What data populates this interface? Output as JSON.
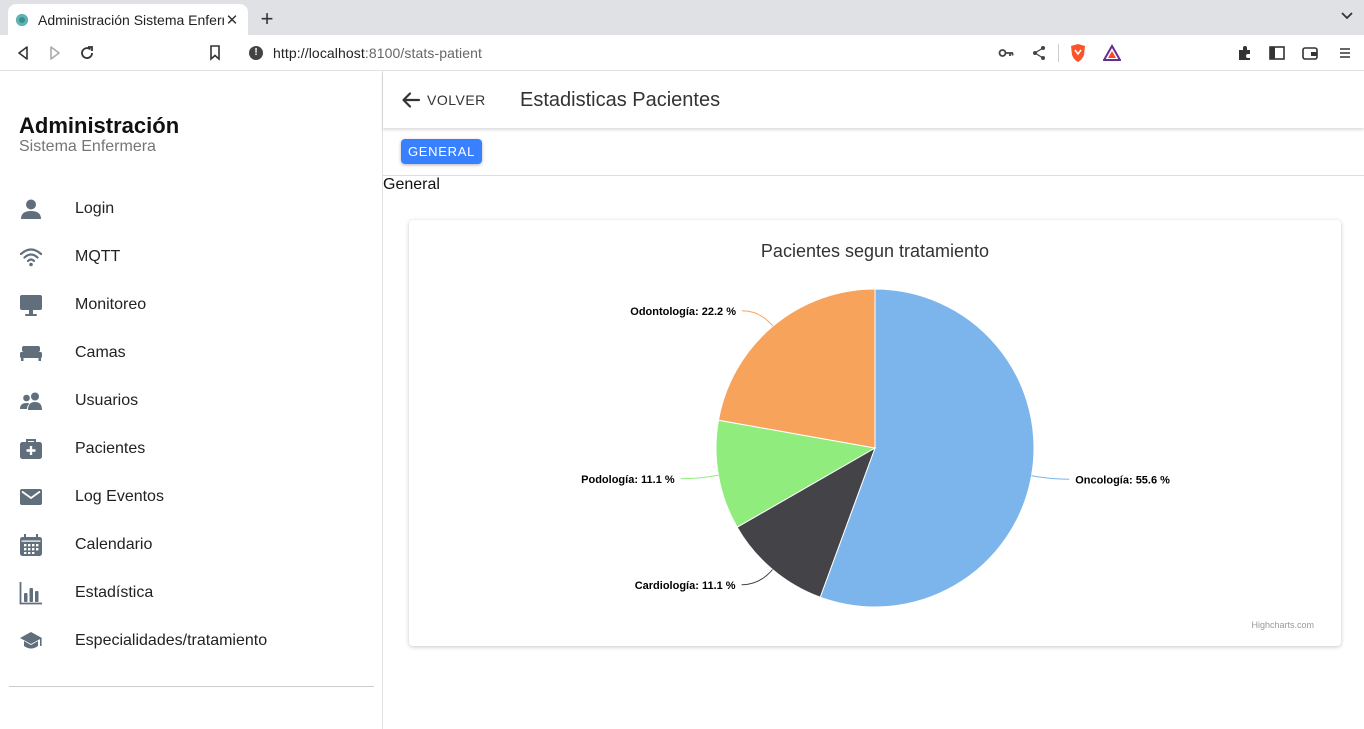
{
  "browser": {
    "tab_title": "Administración Sistema Enfermera",
    "tab_close": "✕",
    "new_tab": "+",
    "url_host": "http://localhost",
    "url_path": ":8100/stats-patient"
  },
  "sidebar": {
    "title": "Administración",
    "subtitle": "Sistema Enfermera",
    "items": [
      {
        "label": "Login",
        "icon": "person-icon"
      },
      {
        "label": "MQTT",
        "icon": "wifi-icon"
      },
      {
        "label": "Monitoreo",
        "icon": "desktop-icon"
      },
      {
        "label": "Camas",
        "icon": "bed-icon"
      },
      {
        "label": "Usuarios",
        "icon": "people-icon"
      },
      {
        "label": "Pacientes",
        "icon": "medkit-icon"
      },
      {
        "label": "Log Eventos",
        "icon": "mail-icon"
      },
      {
        "label": "Calendario",
        "icon": "calendar-icon"
      },
      {
        "label": "Estadística",
        "icon": "stats-chart-icon"
      },
      {
        "label": "Especialidades/tratamiento",
        "icon": "school-icon"
      }
    ]
  },
  "header": {
    "back_label": "VOLVER",
    "title": "Estadisticas Pacientes"
  },
  "segment": {
    "button_label": "GENERAL"
  },
  "section_label": "General",
  "chart_data": {
    "type": "pie",
    "title": "Pacientes segun tratamiento",
    "credits": "Highcharts.com",
    "slices": [
      {
        "name": "Oncología",
        "value": 55.6,
        "label": "Oncología: 55.6 %",
        "color": "#7cb5ec"
      },
      {
        "name": "Cardiología",
        "value": 11.1,
        "label": "Cardiología: 11.1 %",
        "color": "#434348"
      },
      {
        "name": "Podología",
        "value": 11.1,
        "label": "Podología: 11.1 %",
        "color": "#90ed7d"
      },
      {
        "name": "Odontología",
        "value": 22.2,
        "label": "Odontología: 22.2 %",
        "color": "#f7a35c"
      }
    ]
  }
}
